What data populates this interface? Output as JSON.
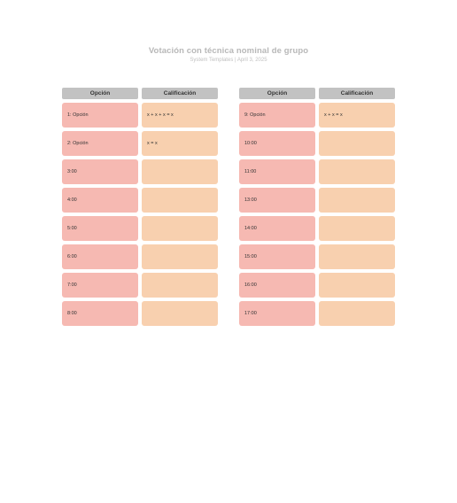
{
  "title": "Votación con técnica nominal de grupo",
  "subtitle": "System Templates  |  April 3, 2025",
  "headers": {
    "option": "Opción",
    "rating": "Calificación"
  },
  "left_rows": [
    {
      "option": "1: Opción",
      "rating": "x + x + x = x"
    },
    {
      "option": "2: Opción",
      "rating": "x = x"
    },
    {
      "option": "3:00",
      "rating": ""
    },
    {
      "option": "4:00",
      "rating": ""
    },
    {
      "option": "5:00",
      "rating": ""
    },
    {
      "option": "6:00",
      "rating": ""
    },
    {
      "option": "7:00",
      "rating": ""
    },
    {
      "option": "8:00",
      "rating": ""
    }
  ],
  "right_rows": [
    {
      "option": "9: Opción",
      "rating": "x + x = x"
    },
    {
      "option": "10:00",
      "rating": ""
    },
    {
      "option": "11:00",
      "rating": ""
    },
    {
      "option": "13:00",
      "rating": ""
    },
    {
      "option": "14:00",
      "rating": ""
    },
    {
      "option": "15:00",
      "rating": ""
    },
    {
      "option": "16:00",
      "rating": ""
    },
    {
      "option": "17:00",
      "rating": ""
    }
  ]
}
